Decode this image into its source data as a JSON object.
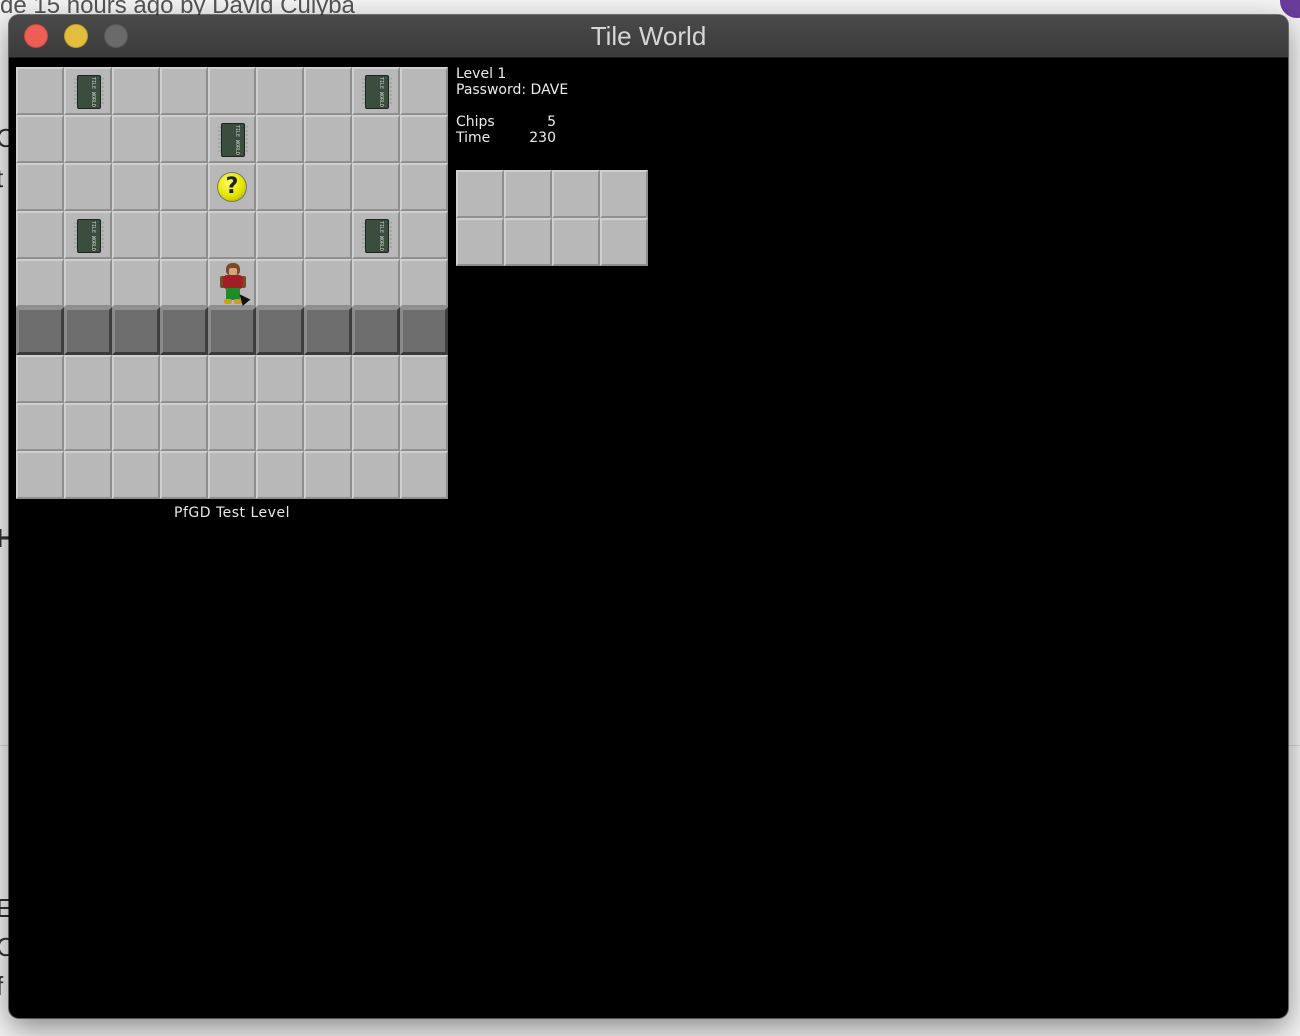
{
  "background": {
    "top_text": "de 15 hours ago by David Culyba",
    "side_letters": [
      "C",
      "t",
      "H",
      "E",
      "C",
      "f"
    ]
  },
  "window": {
    "title": "Tile World",
    "buttons": {
      "close": "close",
      "minimize": "minimize",
      "zoom": "zoom"
    }
  },
  "board": {
    "rows": [
      [
        ".",
        "C",
        ".",
        ".",
        ".",
        ".",
        ".",
        "C",
        "."
      ],
      [
        ".",
        ".",
        ".",
        ".",
        "C",
        ".",
        ".",
        ".",
        "."
      ],
      [
        ".",
        ".",
        ".",
        ".",
        "?",
        ".",
        ".",
        ".",
        "."
      ],
      [
        ".",
        "C",
        ".",
        ".",
        ".",
        ".",
        ".",
        "C",
        "."
      ],
      [
        ".",
        ".",
        ".",
        ".",
        "P",
        ".",
        ".",
        ".",
        "."
      ],
      [
        "W",
        "W",
        "W",
        "W",
        "W",
        "W",
        "W",
        "W",
        "W"
      ],
      [
        ".",
        ".",
        ".",
        ".",
        ".",
        ".",
        ".",
        ".",
        "."
      ],
      [
        ".",
        ".",
        ".",
        ".",
        ".",
        ".",
        ".",
        ".",
        "."
      ],
      [
        ".",
        ".",
        ".",
        ".",
        ".",
        ".",
        ".",
        ".",
        "."
      ]
    ],
    "legend": {
      ".": "floor",
      "C": "computer-chip",
      "?": "hint",
      "P": "player",
      "W": "wall"
    },
    "chip_label": "TILE WORLD",
    "hint_glyph": "?",
    "level_title": "PfGD Test Level"
  },
  "info": {
    "level_label": "Level 1",
    "password_label": "Password: DAVE",
    "chips_label": "Chips",
    "chips_value": "5",
    "time_label": "Time",
    "time_value": "230"
  },
  "inventory": {
    "rows": 2,
    "cols": 4
  },
  "colors": {
    "floor": "#b8b8b8",
    "wall": "#6e6e6e",
    "window_bg": "#000000",
    "titlebar": "#3f3f3f",
    "close": "#ed5e56",
    "minimize": "#e2bd3e"
  }
}
